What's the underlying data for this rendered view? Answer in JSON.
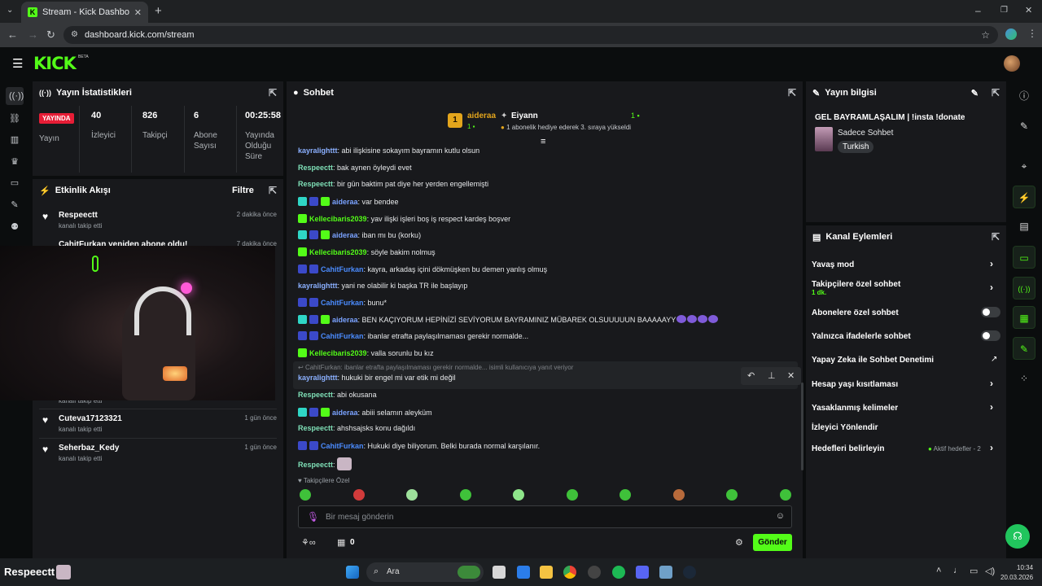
{
  "browser": {
    "tab_title": "Stream - Kick Dashboard",
    "url": "dashboard.kick.com/stream",
    "new_tab": "+"
  },
  "header": {
    "logo": "KICK",
    "beta": "BETA"
  },
  "stats": {
    "title": "Yayın İstatistikleri",
    "live_badge": "YAYINDA",
    "live_label": "Yayın",
    "viewers_value": "40",
    "viewers_label": "İzleyici",
    "followers_value": "826",
    "followers_label": "Takipçi",
    "subs_value": "6",
    "subs_label": "Abone Sayısı",
    "uptime_value": "00:25:58",
    "uptime_label": "Yayında Olduğu Süre"
  },
  "activity": {
    "title": "Etkinlik Akışı",
    "filter": "Filtre",
    "items": [
      {
        "name": "Respeectt",
        "desc": "kanalı takip etti",
        "time": "2 dakika önce"
      },
      {
        "name": "CahitFurkan yeniden abone oldu!",
        "desc": "",
        "time": "7 dakika önce"
      },
      {
        "name": "Cuteva17123321",
        "desc": "kanalı takip etti",
        "time": "1 gün önce"
      },
      {
        "name": "Seherbaz_Kedy",
        "desc": "kanalı takip etti",
        "time": "1 gün önce"
      }
    ],
    "cut_desc": "kanalı takip etti"
  },
  "chat": {
    "title": "Sohbet",
    "leader1_rank": "1",
    "leader1_name": "aideraa",
    "leader1_count": "1",
    "leader2_name": "Eiyann",
    "leader2_count": "1",
    "leader2_desc": "1 abonelik hediye ederek 3. sıraya yükseldi",
    "messages": [
      {
        "user": "kayralighttt",
        "text": ": abi ilişkisine sokayım bayramın kutlu olsun"
      },
      {
        "user": "Respeectt",
        "text": ": bak aynen öyleydi evet"
      },
      {
        "user": "Respeectt",
        "text": ": bir gün baktim pat diye her yerden engellemişti"
      },
      {
        "user": "aideraa",
        "text": ": var bendee"
      },
      {
        "user": "Kellecibaris2039",
        "text": ": yav ilişki işleri boş iş respect kardeş boşver"
      },
      {
        "user": "aideraa",
        "text": ": iban mı bu (korku)"
      },
      {
        "user": "Kellecibaris2039",
        "text": ": söyle bakim nolmuş"
      },
      {
        "user": "CahitFurkan",
        "text": ": kayra, arkadaş içini dökmüşken bu demen yanlış olmuş"
      },
      {
        "user": "kayralighttt",
        "text": ": yani ne olabilir ki başka TR ile başlayıp"
      },
      {
        "user": "CahitFurkan",
        "text": ": bunu*"
      },
      {
        "user": "aideraa",
        "text": ": BEN KAÇIYORUM HEPİNİZİ SEVİYORUM BAYRAMINIZ MÜBAREK OLSUUUUUN BAAAAAYY"
      },
      {
        "user": "CahitFurkan",
        "text": ": ibanlar etrafta paylaşılmaması gerekir normalde..."
      },
      {
        "user": "Kellecibaris2039",
        "text": ": valla sorunlu bu kız"
      },
      {
        "user": "kayralighttt",
        "text": ": hukuki bir engel mi var etik mi değil"
      },
      {
        "user": "Respeectt",
        "text": ": abi okusana"
      },
      {
        "user": "aideraa",
        "text": ": abiii selamın aleyküm"
      },
      {
        "user": "Respeectt",
        "text": ": ahshsajsks konu dağıldı"
      },
      {
        "user": "CahitFurkan",
        "text": ": Hukuki diye biliyorum. Belki burada normal karşılanır."
      },
      {
        "user": "Respeectt",
        "text": ":"
      }
    ],
    "reply_hint": "CahitFurkan: ibanlar etrafta paylaşılmaması gerekir normalde... isimli kullanıcıya yanıt veriyor",
    "followers_only": "Takipçilere Özel",
    "input_placeholder": "Bir mesaj gönderin",
    "link_count": "0",
    "send": "Gönder"
  },
  "stream_info": {
    "title": "Yayın bilgisi",
    "stream_title": "GEL BAYRAMLAŞALIM | !insta !donate",
    "category": "Sadece Sohbet",
    "language": "Turkish"
  },
  "channel_actions": {
    "title": "Kanal Eylemleri",
    "slow_mode": "Yavaş mod",
    "followers_chat": "Takipçilere özel sohbet",
    "followers_chat_sub": "1 dk.",
    "subs_chat": "Abonelere özel sohbet",
    "emote_chat": "Yalnızca ifadelerle sohbet",
    "ai_mod": "Yapay Zeka ile Sohbet Denetimi",
    "age_restrict": "Hesap yaşı kısıtlaması",
    "banned_words": "Yasaklanmış kelimeler",
    "raid": "İzleyici Yönlendir",
    "goals": "Hedefleri belirleyin",
    "goals_status": "Aktif hedefler - 2"
  },
  "overlay": {
    "bottom_name": "Respeectt :"
  },
  "taskbar": {
    "search": "Ara",
    "time": "10:34",
    "date": "20.03.2026"
  },
  "colors": {
    "kick_green": "#53fc18",
    "live_red": "#e71d36",
    "panel": "#18191c"
  }
}
